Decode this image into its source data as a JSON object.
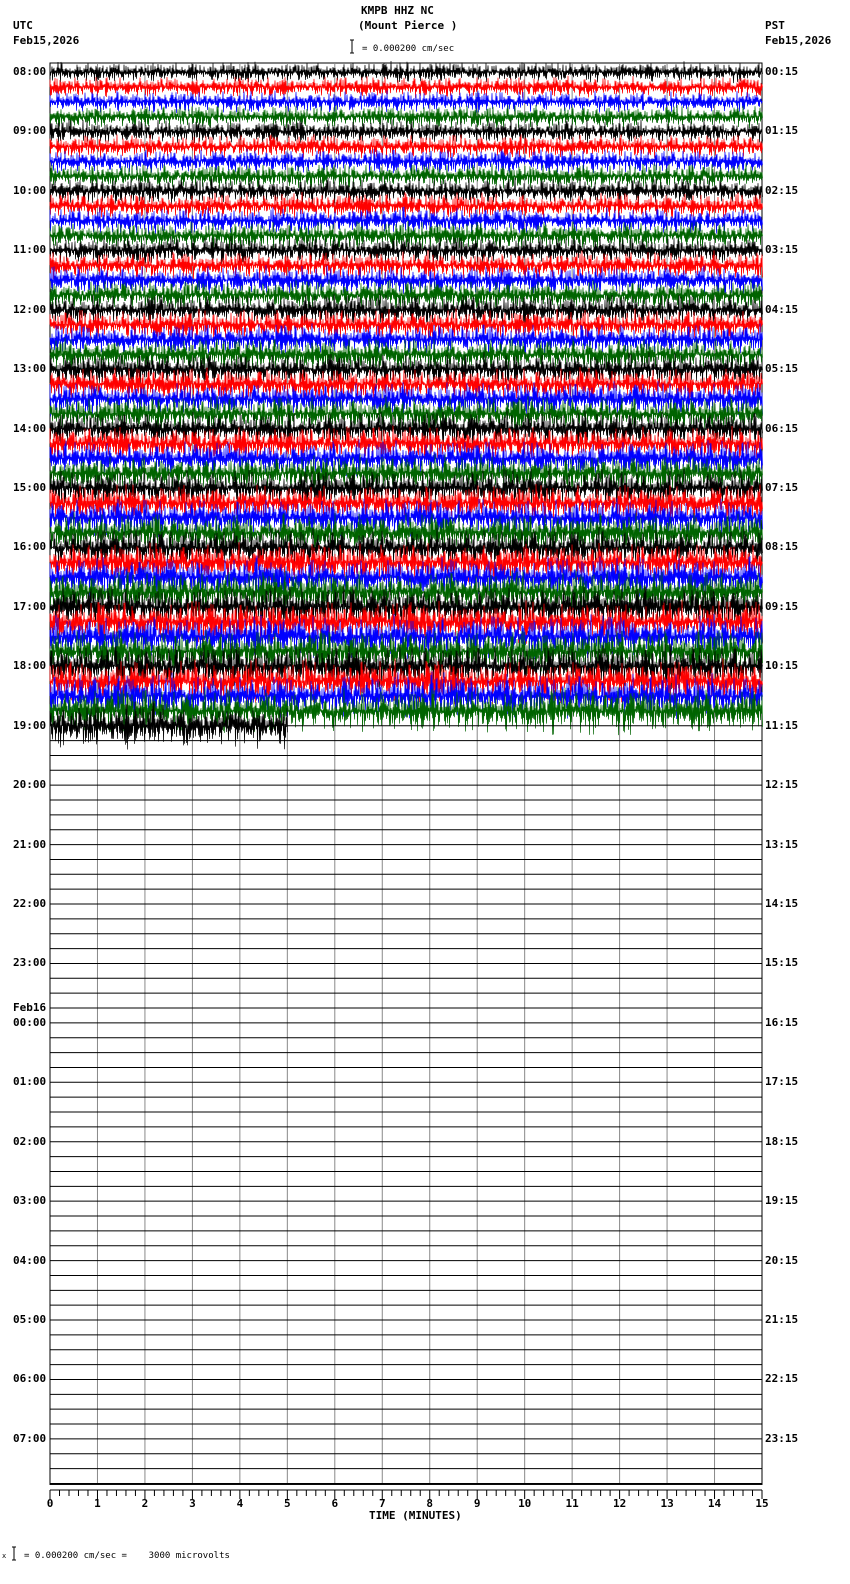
{
  "chart_data": {
    "type": "line",
    "title": "KMPB HHZ NC",
    "subtitle": "(Mount Pierce )",
    "left_zone": "UTC",
    "left_date": "Feb15,2026",
    "right_zone": "PST",
    "right_date": "Feb15,2026",
    "scale_label": "= 0.000200 cm/sec",
    "footer_scale": "= 0.000200 cm/sec =    3000 microvolts",
    "footer_mark": "x",
    "xlabel": "TIME (MINUTES)",
    "xlim": [
      0,
      15
    ],
    "x_ticks": [
      "0",
      "1",
      "2",
      "3",
      "4",
      "5",
      "6",
      "7",
      "8",
      "9",
      "10",
      "11",
      "12",
      "13",
      "14",
      "15"
    ],
    "left_hour_labels": [
      "08:00",
      "09:00",
      "10:00",
      "11:00",
      "12:00",
      "13:00",
      "14:00",
      "15:00",
      "16:00",
      "17:00",
      "18:00",
      "19:00",
      "20:00",
      "21:00",
      "22:00",
      "23:00",
      "00:00",
      "01:00",
      "02:00",
      "03:00",
      "04:00",
      "05:00",
      "06:00",
      "07:00"
    ],
    "date_change_label": "Feb16",
    "right_hour_labels": [
      "00:15",
      "01:15",
      "02:15",
      "03:15",
      "04:15",
      "05:15",
      "06:15",
      "07:15",
      "08:15",
      "09:15",
      "10:15",
      "11:15",
      "12:15",
      "13:15",
      "14:15",
      "15:15",
      "16:15",
      "17:15",
      "18:15",
      "19:15",
      "20:15",
      "21:15",
      "22:15",
      "23:15"
    ],
    "traces_per_hour": 4,
    "trace_colors": [
      "#000000",
      "#ff0000",
      "#0000ff",
      "#006400"
    ],
    "data_end": {
      "hour_label": "19:00",
      "minutes": 5
    },
    "grid": true
  }
}
